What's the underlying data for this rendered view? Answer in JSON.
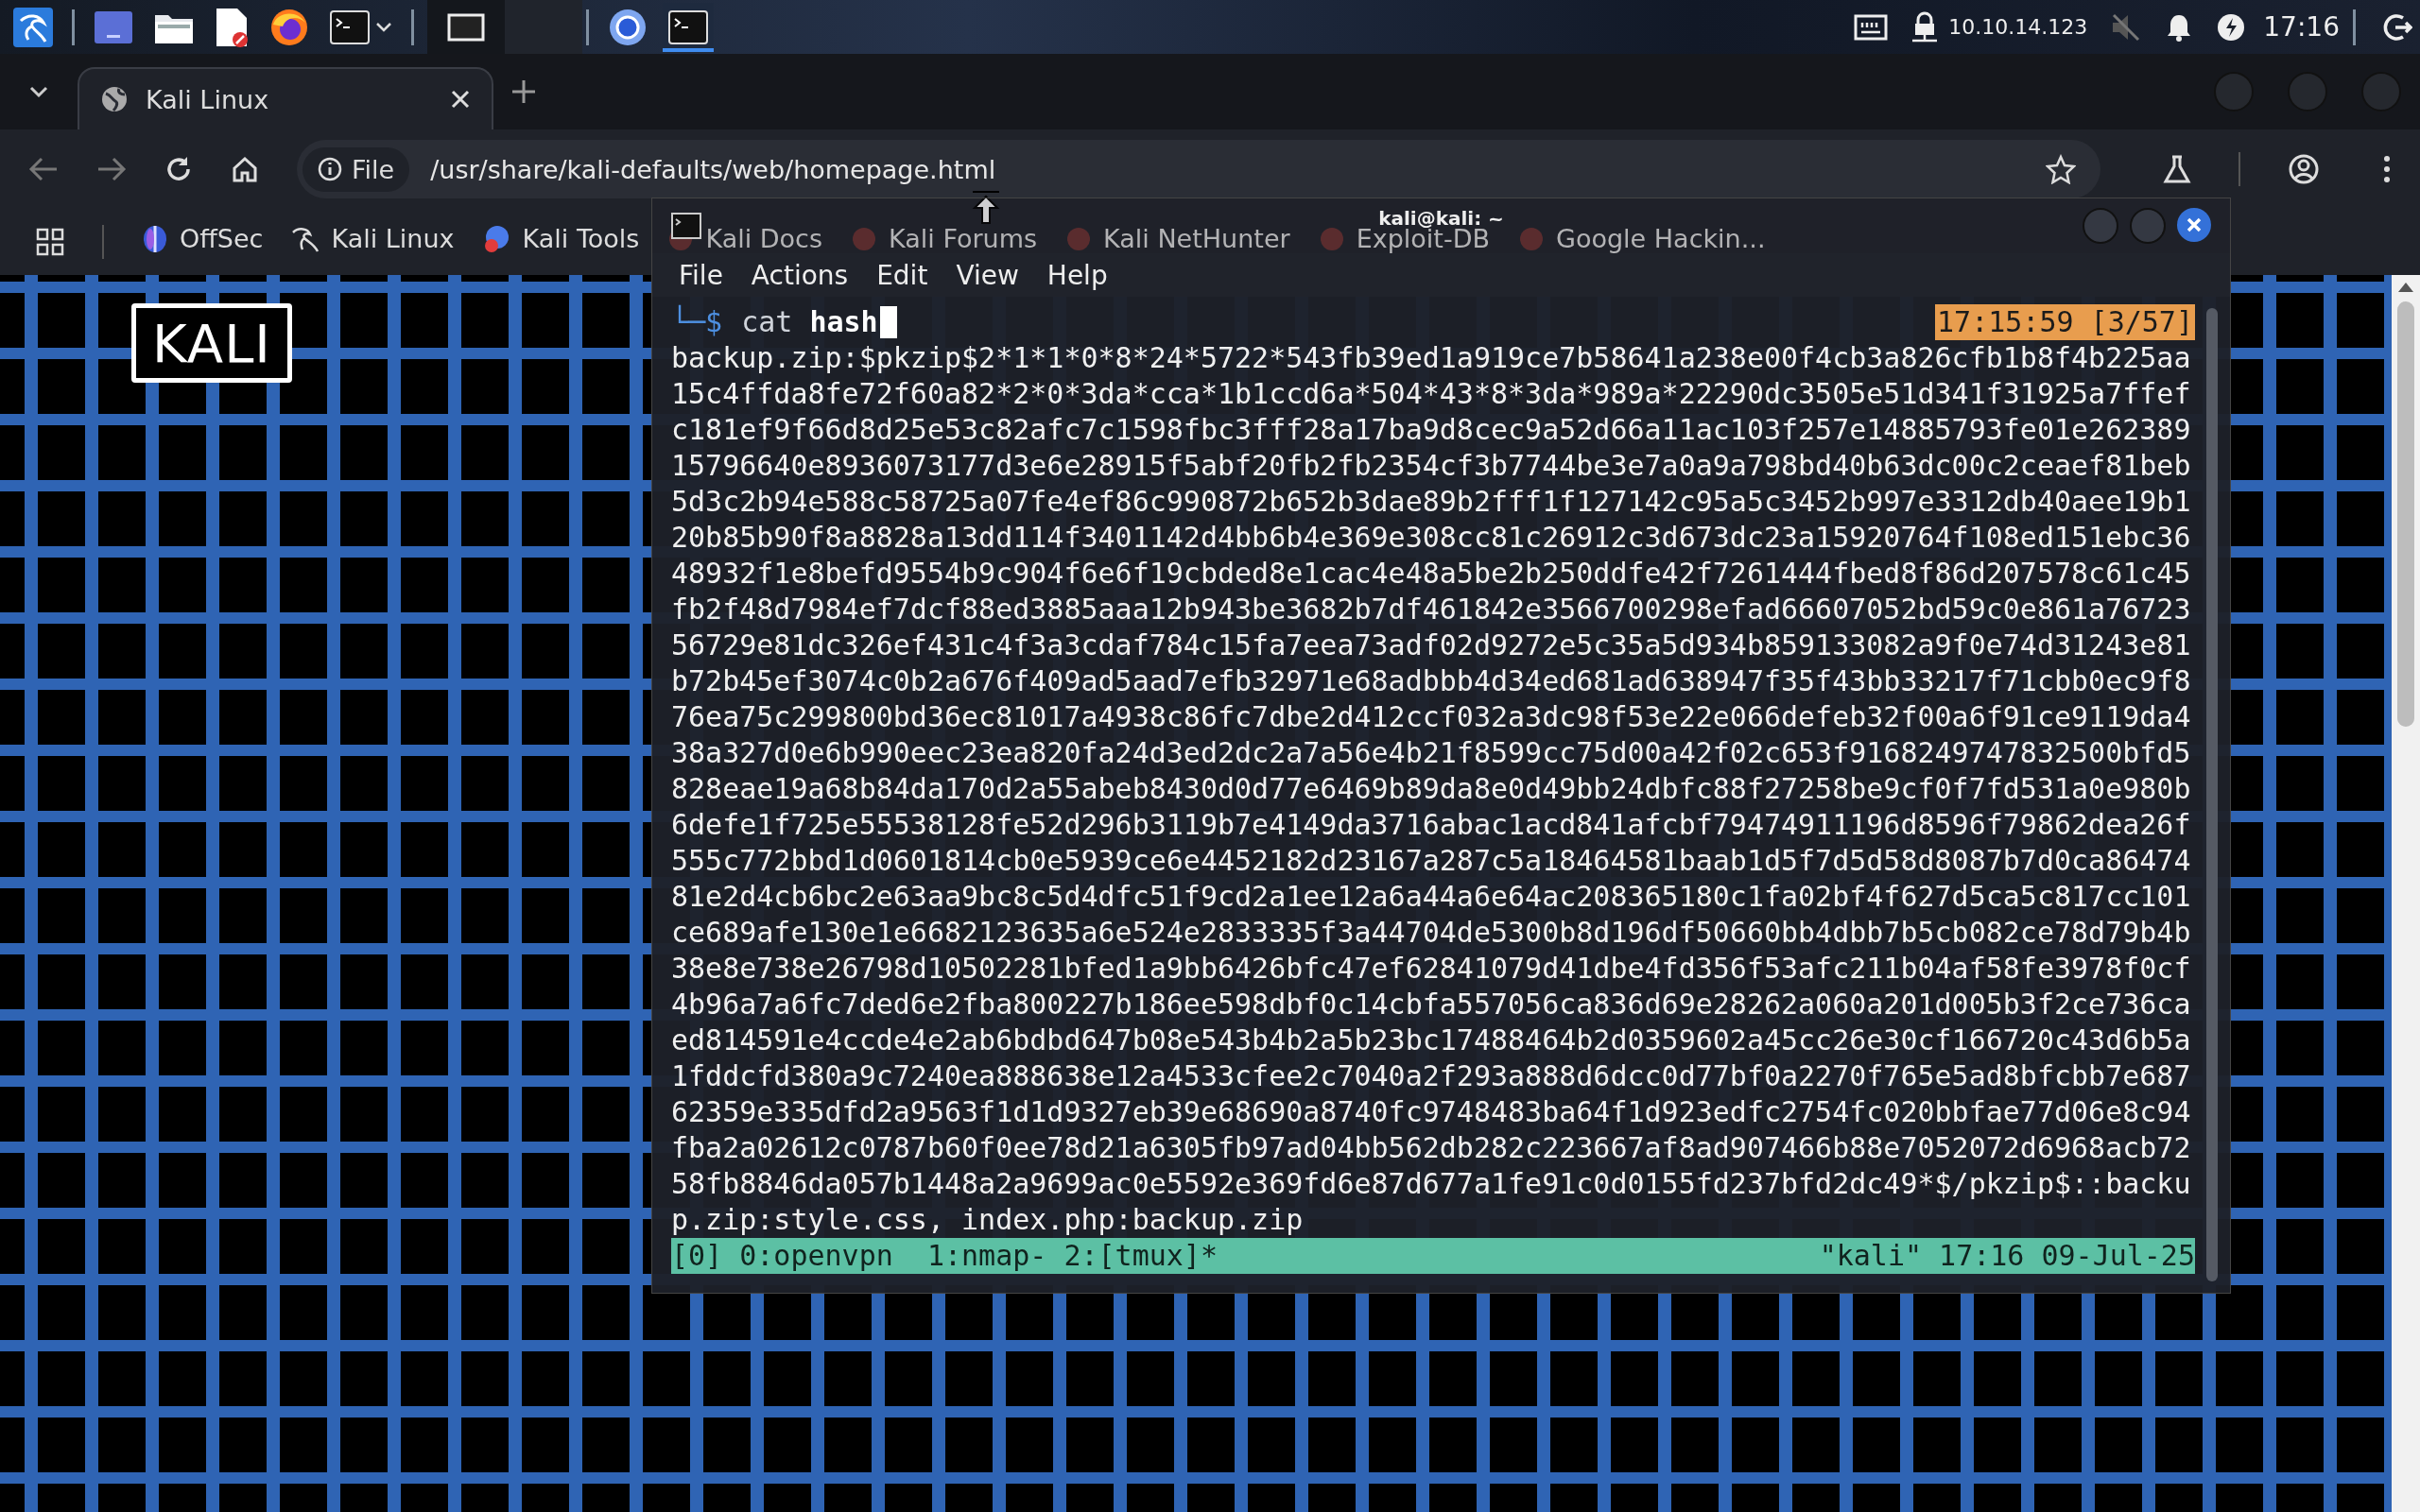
{
  "taskbar": {
    "apps": [
      {
        "kind": "menu",
        "selected": false
      },
      {
        "kind": "desktop",
        "selected": false
      },
      {
        "kind": "files",
        "selected": false
      },
      {
        "kind": "editor",
        "selected": false
      },
      {
        "kind": "firefox",
        "selected": false
      },
      {
        "kind": "terminal-launcher",
        "selected": false
      }
    ],
    "workspaces": [
      {
        "selected": true
      },
      {
        "selected": false
      }
    ],
    "windows": [
      {
        "kind": "chromium",
        "selected": false
      },
      {
        "kind": "terminal",
        "selected": true
      }
    ],
    "tray": {
      "ip": "10.10.14.123",
      "muted": true,
      "clock": "17:16"
    }
  },
  "browser": {
    "tabs": [
      {
        "title": "Kali Linux",
        "selected": true
      }
    ],
    "url_chip": "File",
    "url": "/usr/share/kali-defaults/web/homepage.html",
    "bookmarks": [
      {
        "label": "OffSec",
        "kind": "offsec"
      },
      {
        "label": "Kali Linux",
        "kind": "kali"
      },
      {
        "label": "Kali Tools",
        "kind": "tools"
      },
      {
        "label": "Kali Docs",
        "kind": "docs"
      },
      {
        "label": "Kali Forums",
        "kind": "forums"
      },
      {
        "label": "Kali NetHunter",
        "kind": "nethunter"
      },
      {
        "label": "Exploit-DB",
        "kind": "exploitdb"
      },
      {
        "label": "Google Hackin...",
        "kind": "ghdb"
      }
    ]
  },
  "page": {
    "logo": "KALI"
  },
  "terminal": {
    "title": "kali@kali: ~",
    "menu": [
      "File",
      "Actions",
      "Edit",
      "View",
      "Help"
    ],
    "prompt": "└─$",
    "command": "cat **hash**",
    "pane_info": "17:15:59 [3/57]",
    "output": [
      "backup.zip:$pkzip$2*1*1*0*8*24*5722*543fb39ed1a919ce7b58641a238e00f4cb3a826cfb1b8f4b225aa",
      "15c4ffda8fe72f60a82*2*0*3da*cca*1b1ccd6a*504*43*8*3da*989a*22290dc3505e51d341f31925a7ffef",
      "c181ef9f66d8d25e53c82afc7c1598fbc3fff28a17ba9d8cec9a52d66a11ac103f257e14885793fe01e262389",
      "15796640e8936073177d3e6e28915f5abf20fb2fb2354cf3b7744be3e7a0a9a798bd40b63dc00c2ceaef81beb",
      "5d3c2b94e588c58725a07fe4ef86c990872b652b3dae89b2fff1f127142c95a5c3452b997e3312db40aee19b1",
      "20b85b90f8a8828a13dd114f3401142d4bb6b4e369e308cc81c26912c3d673dc23a15920764f108ed151ebc36",
      "48932f1e8befd9554b9c904f6e6f19cbded8e1cac4e48a5be2b250ddfe42f7261444fbed8f86d207578c61c45",
      "fb2f48d7984ef7dcf88ed3885aaa12b943be3682b7df461842e3566700298efad66607052bd59c0e861a76723",
      "56729e81dc326ef431c4f3a3cdaf784c15fa7eea73adf02d9272e5c35a5d934b859133082a9f0e74d31243e81",
      "b72b45ef3074c0b2a676f409ad5aad7efb32971e68adbbb4d34ed681ad638947f35f43bb33217f71cbb0ec9f8",
      "76ea75c299800bd36ec81017a4938c86fc7dbe2d412ccf032a3dc98f53e22e066defeb32f00a6f91ce9119da4",
      "38a327d0e6b990eec23ea820fa24d3ed2dc2a7a56e4b21f8599cc75d00a42f02c653f9168249747832500bfd5",
      "828eae19a68b84da170d2a55abeb8430d0d77e6469b89da8e0d49bb24dbfc88f27258be9cf0f7fd531a0e980b",
      "6defe1f725e55538128fe52d296b3119b7e4149da3716abac1acd841afcbf79474911196d8596f79862dea26f",
      "555c772bbd1d0601814cb0e5939ce6e4452182d23167a287c5a18464581baab1d5f7d5d58d8087b7d0ca86474",
      "81e2d4cb6bc2e63aa9bc8c5d4dfc51f9cd2a1ee12a6a44a6e64ac208365180c1fa02bf4f627d5ca5c817cc101",
      "ce689afe130e1e6682123635a6e524e2833335f3a44704de5300b8d196df50660bb4dbb7b5cb082ce78d79b4b",
      "38e8e738e26798d10502281bfed1a9bb6426bfc47ef62841079d41dbe4fd356f53afc211b04af58fe3978f0cf",
      "4b96a7a6fc7ded6e2fba800227b186ee598dbf0c14cbfa557056ca836d69e28262a060a201d005b3f2ce736ca",
      "ed814591e4ccde4e2ab6bdbd647b08e543b4b2a5b23bc17488464b2d0359602a45cc26e30cf166720c43d6b5a",
      "1fddcfd380a9c7240ea888638e12a4533cfee2c7040a2f293a888d6dcc0d77bf0a2270f765e5ad8bfcbb7e687",
      "62359e335dfd2a9563f1d1d9327eb39e68690a8740fc9748483ba64f1d923edfc2754fc020bbfae77d06e8c94",
      "fba2a02612c0787b60f0ee78d21a6305fb97ad04bb562db282c223667af8ad907466b88e7052072d6968acb72",
      "58fb8846da057b1448a2a9699ac0e5592e369fd6e87d677a1fe91c0d0155fd237bfd2dc49*$/pkzip$::backu",
      "p.zip:style.css, index.php:backup.zip"
    ],
    "status_left": "[0] 0:openvpn  1:nmap- 2:[tmux]*",
    "status_right": "\"kali\" 17:16 09-Jul-25"
  }
}
